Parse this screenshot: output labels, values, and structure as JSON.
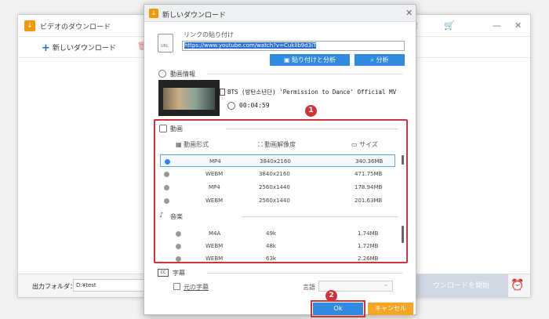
{
  "main_window": {
    "title": "ビデオのダウンロード",
    "new_download": "新しいダウンロード",
    "output_folder_label": "出力フォルダ：",
    "output_folder_value": "D:¥test",
    "start_download": "ウンロードを開始"
  },
  "dialog": {
    "title": "新しいダウンロード",
    "paste_link_label": "リンクの貼り付け",
    "url_value": "https://www.youtube.com/watch?v=CuklIb9d3lT",
    "paste_analyze_button": "貼り付けと分析",
    "analyze_button": "分析",
    "video_info_label": "動画情報",
    "video_title": "BTS (방탄소년단) 'Permission to Dance' Official MV",
    "duration": "00:04:59",
    "video_section_label": "動画",
    "columns": [
      "動画形式",
      "動画解像度",
      "サイズ"
    ],
    "video_rows": [
      {
        "format": "MP4",
        "resolution": "3840x2160",
        "size": "340.36MB",
        "selected": true
      },
      {
        "format": "WEBM",
        "resolution": "3840x2160",
        "size": "471.75MB",
        "selected": false
      },
      {
        "format": "MP4",
        "resolution": "2560x1440",
        "size": "178.94MB",
        "selected": false
      },
      {
        "format": "WEBM",
        "resolution": "2560x1440",
        "size": "201.63MB",
        "selected": false
      }
    ],
    "audio_section_label": "音楽",
    "audio_rows": [
      {
        "format": "M4A",
        "bitrate": "49k",
        "size": "1.74MB"
      },
      {
        "format": "WEBM",
        "bitrate": "48k",
        "size": "1.72MB"
      },
      {
        "format": "WEBM",
        "bitrate": "63k",
        "size": "2.26MB"
      }
    ],
    "subtitle_section_label": "字幕",
    "original_subtitle": "元の字幕",
    "language_label": "言語",
    "ok_button": "Ok",
    "cancel_button": "キャンセル",
    "badge_1": "1",
    "badge_2": "2"
  },
  "colors": {
    "accent_blue": "#2f8ae0",
    "highlight_red": "#d0343a",
    "cancel_orange": "#f5a623",
    "logo_orange": "#f39800"
  }
}
